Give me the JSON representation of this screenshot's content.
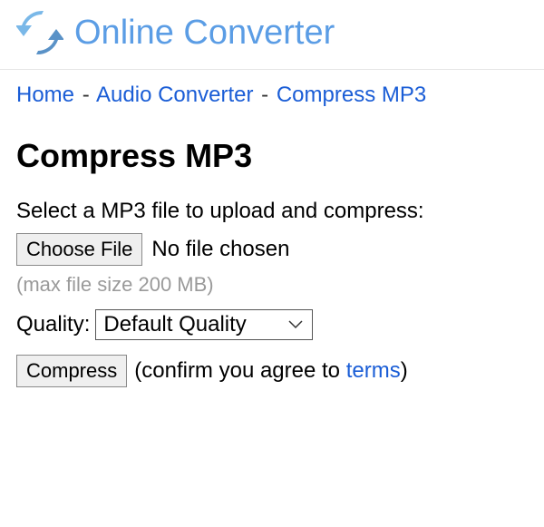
{
  "header": {
    "site_title": "Online Converter"
  },
  "breadcrumb": {
    "items": [
      "Home",
      "Audio Converter",
      "Compress MP3"
    ],
    "separator": "-"
  },
  "page": {
    "title": "Compress MP3",
    "instruction": "Select a MP3 file to upload and compress:",
    "choose_file_label": "Choose File",
    "file_status": "No file chosen",
    "max_size_hint": "(max file size 200 MB)",
    "quality_label": "Quality:",
    "quality_selected": "Default Quality",
    "compress_label": "Compress",
    "agree_prefix": "(confirm you agree to ",
    "terms_label": "terms",
    "agree_suffix": ")"
  }
}
